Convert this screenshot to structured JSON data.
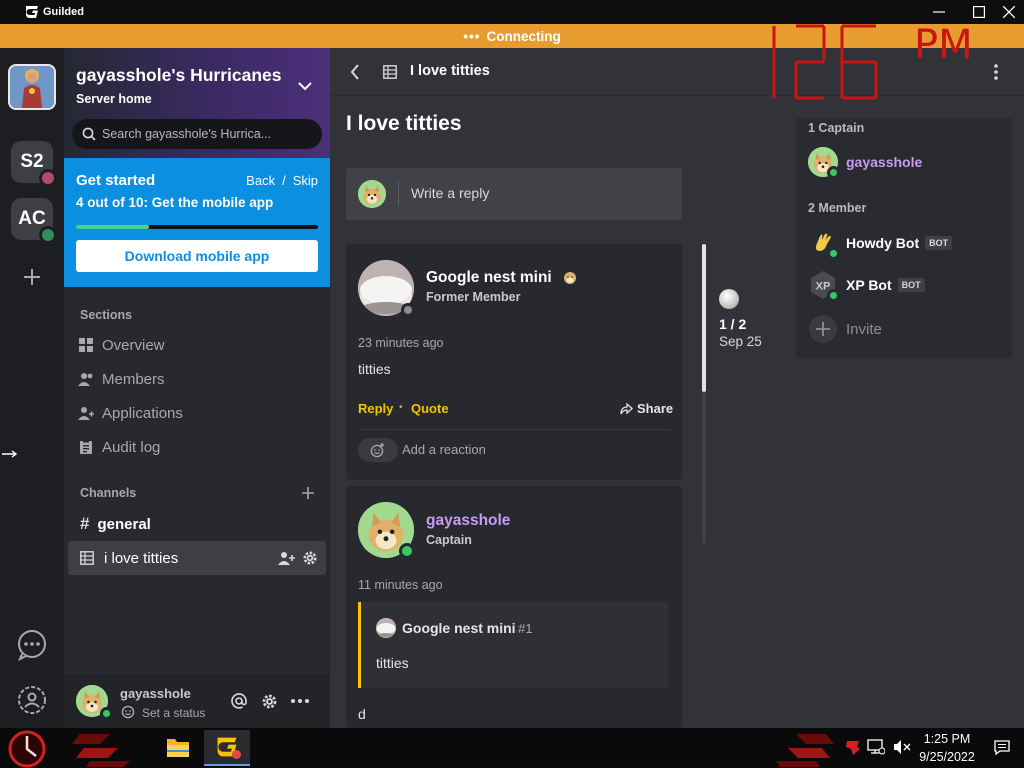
{
  "window": {
    "app_name": "Guilded"
  },
  "connection": {
    "status": "Connecting",
    "dots": "•••"
  },
  "overlay": {
    "clock_ampm": "PM"
  },
  "rail": {
    "servers": [
      {
        "label": "S2"
      },
      {
        "label": "AC"
      }
    ]
  },
  "sidebar": {
    "server_name": "gayasshole's Hurricanes",
    "server_sub": "Server home",
    "search_placeholder": "Search gayasshole's Hurrica...",
    "get_started": {
      "title": "Get started",
      "back": "Back",
      "sep": "/",
      "skip": "Skip",
      "step": "4 out of 10: Get the mobile app",
      "progress": 0.3,
      "button": "Download mobile app"
    },
    "sections_label": "Sections",
    "sections": [
      {
        "label": "Overview"
      },
      {
        "label": "Members"
      },
      {
        "label": "Applications"
      },
      {
        "label": "Audit log"
      }
    ],
    "channels_label": "Channels",
    "channels": [
      {
        "label": "general"
      },
      {
        "label": "i love titties"
      }
    ],
    "user": {
      "name": "gayasshole",
      "status": "Set a status"
    }
  },
  "main": {
    "topbar_title": "I love titties",
    "thread_title": "I love titties",
    "reply_placeholder": "Write a reply",
    "posts": [
      {
        "author": "Google nest mini",
        "role": "Former Member",
        "time": "23 minutes ago",
        "body": "titties",
        "reply": "Reply",
        "sep": "•",
        "quote": "Quote",
        "share": "Share",
        "add_reaction": "Add a reaction"
      },
      {
        "author": "gayasshole",
        "role": "Captain",
        "time": "11 minutes ago",
        "quoted_author": "Google nest mini",
        "quoted_ref": "#1",
        "quoted_body": "titties",
        "body": "d"
      }
    ],
    "pager": {
      "position": "1 / 2",
      "date": "Sep 25"
    },
    "members": {
      "captain_header": "1 Captain",
      "member_header": "2 Member",
      "captains": [
        {
          "name": "gayasshole"
        }
      ],
      "members": [
        {
          "name": "Howdy Bot",
          "badge": "BOT"
        },
        {
          "name": "XP Bot",
          "badge": "BOT"
        }
      ],
      "invite": "Invite"
    }
  },
  "taskbar": {
    "time": "1:25 PM",
    "date": "9/25/2022"
  },
  "colors": {
    "accent_blue": "#0b8fe0",
    "connecting_orange": "#e69c2e",
    "captain_purple": "#c79cf2",
    "link_yellow": "#f5c400",
    "online_green": "#37c864"
  }
}
